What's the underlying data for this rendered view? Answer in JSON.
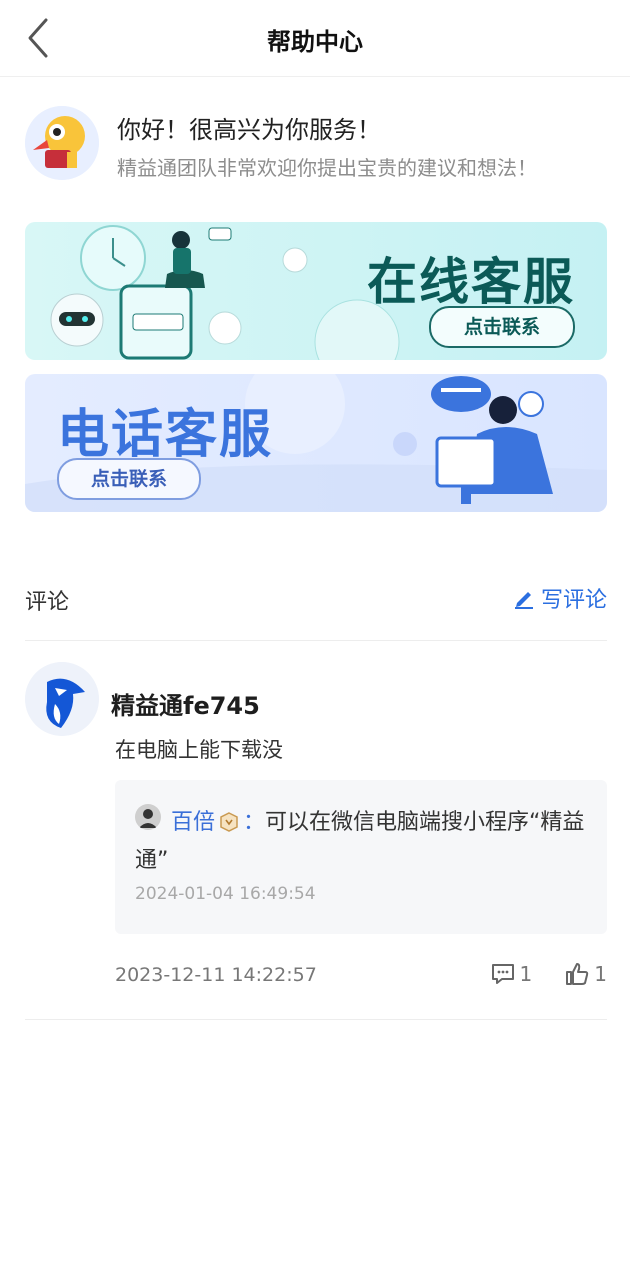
{
  "header": {
    "title": "帮助中心"
  },
  "greeting": {
    "title": "你好！很高兴为你服务！",
    "subtitle": "精益通团队非常欢迎你提出宝贵的建议和想法！"
  },
  "banners": {
    "online": {
      "title": "在线客服",
      "button": "点击联系"
    },
    "phone": {
      "title": "电话客服",
      "button": "点击联系"
    }
  },
  "comments_section": {
    "title": "评论",
    "write_label": "写评论"
  },
  "comment": {
    "author": "精益通fe745",
    "text": "在电脑上能下载没",
    "reply": {
      "author": "百倍",
      "colon": "：",
      "text": "可以在微信电脑端搜小程序“精益通”",
      "time": "2024-01-04 16:49:54"
    },
    "time": "2023-12-11 14:22:57",
    "reply_count": "1",
    "like_count": "1"
  },
  "colors": {
    "accent": "#2b6fe0",
    "online_banner": "#c9f2f3",
    "phone_banner": "#dde7ff"
  },
  "icons": [
    "back-chevron-icon",
    "mascot-avatar",
    "edit-pencil-icon",
    "bird-logo-avatar",
    "badge-icon",
    "comment-icon",
    "like-icon"
  ]
}
